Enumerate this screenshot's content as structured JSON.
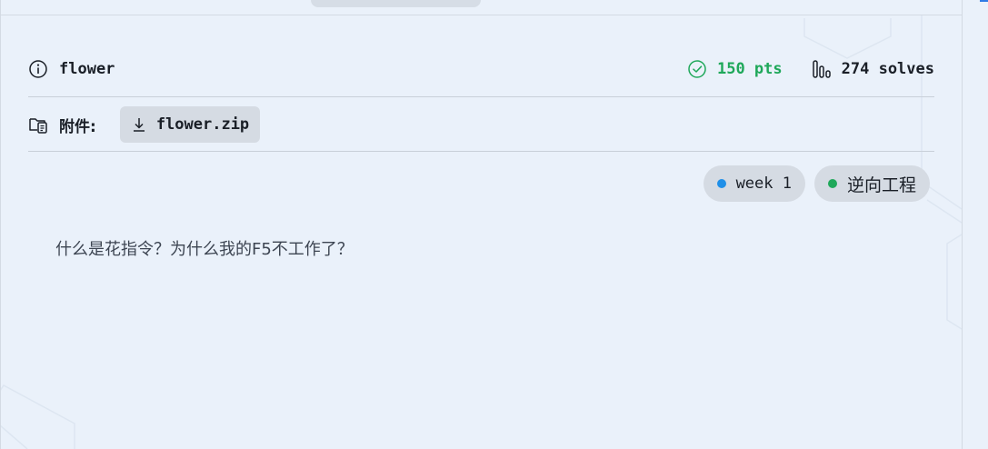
{
  "challenge": {
    "title": "flower",
    "points": "150 pts",
    "solves": "274 solves",
    "description": "什么是花指令？为什么我的F5不工作了？"
  },
  "attachments": {
    "label": "附件:",
    "files": [
      {
        "name": "flower.zip"
      }
    ]
  },
  "tags": [
    {
      "label": "week 1",
      "color": "#1f8fe8"
    },
    {
      "label": "逆向工程",
      "color": "#1fa85a"
    }
  ],
  "colors": {
    "background": "#eaf1fa",
    "points": "#1fa85a",
    "tag_background": "#d5dbe3"
  },
  "icons": {
    "title": "info-icon",
    "points": "check-circle-icon",
    "solves": "bar-chart-icon",
    "attachments": "folder-file-icon",
    "download": "download-icon"
  }
}
